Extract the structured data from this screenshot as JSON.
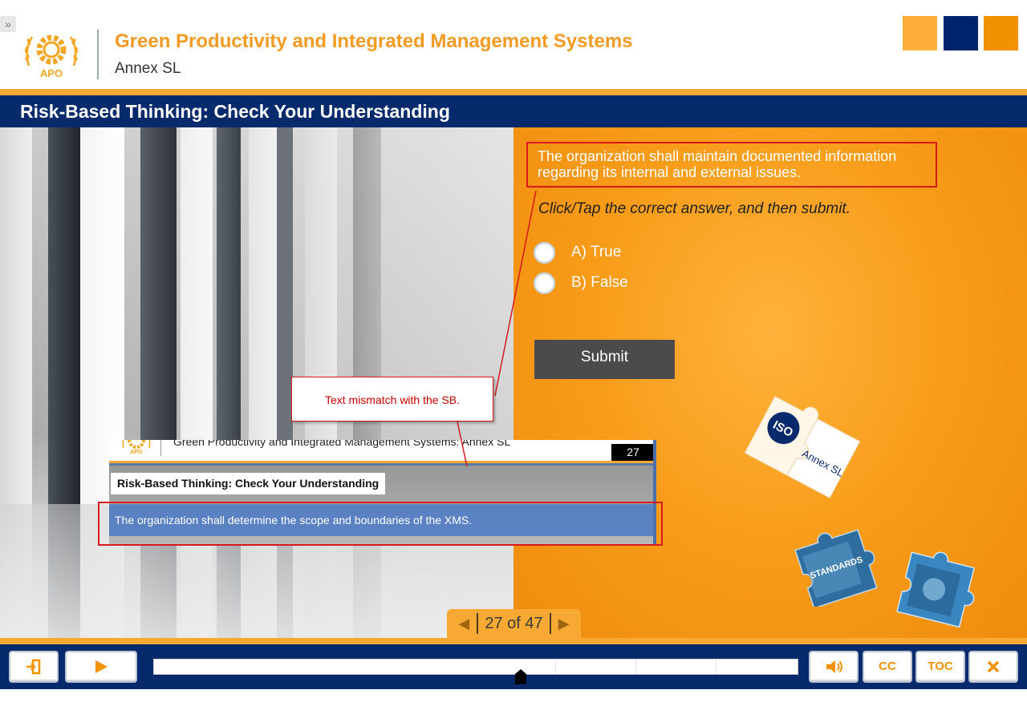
{
  "header": {
    "expand_glyph": "»",
    "title": "Green Productivity and Integrated Management Systems",
    "subtitle": "Annex SL",
    "logo_text": "APO",
    "color_squares": [
      "#ffae3c",
      "#00246b",
      "#f29200"
    ]
  },
  "slide": {
    "title": "Risk-Based Thinking: Check Your Understanding",
    "question": "The organization shall maintain documented information regarding its internal and external issues.",
    "instruction": "Click/Tap the correct answer, and then submit.",
    "options": [
      {
        "label": "A) True"
      },
      {
        "label": "B) False"
      }
    ],
    "submit_label": "Submit"
  },
  "annotation": {
    "callout_text": "Text mismatch with the SB.",
    "color": "#d71920"
  },
  "storyboard": {
    "header_text": "Green Productivity and Integrated Management Systems: Annex SL",
    "page_number": "27",
    "title": "Risk-Based Thinking: Check Your Understanding",
    "question": "The organization shall determine the scope and boundaries of the XMS."
  },
  "puzzles": {
    "iso_label": "ISO",
    "annex_label": "Annex SL",
    "standards_label": "STANDARDS"
  },
  "page_nav": {
    "prev_icon": "triangle-left",
    "next_icon": "triangle-right",
    "counter": "27 of 47"
  },
  "controls": {
    "exit_icon": "exit-door",
    "play_icon": "play-triangle",
    "audio_icon": "speaker",
    "cc_label": "CC",
    "toc_label": "TOC",
    "close_icon": "x-mark",
    "progress": 0.57
  },
  "colors": {
    "brand_orange": "#f7a933",
    "brand_navy": "#072a6c",
    "stage_orange": "#f89c19"
  }
}
